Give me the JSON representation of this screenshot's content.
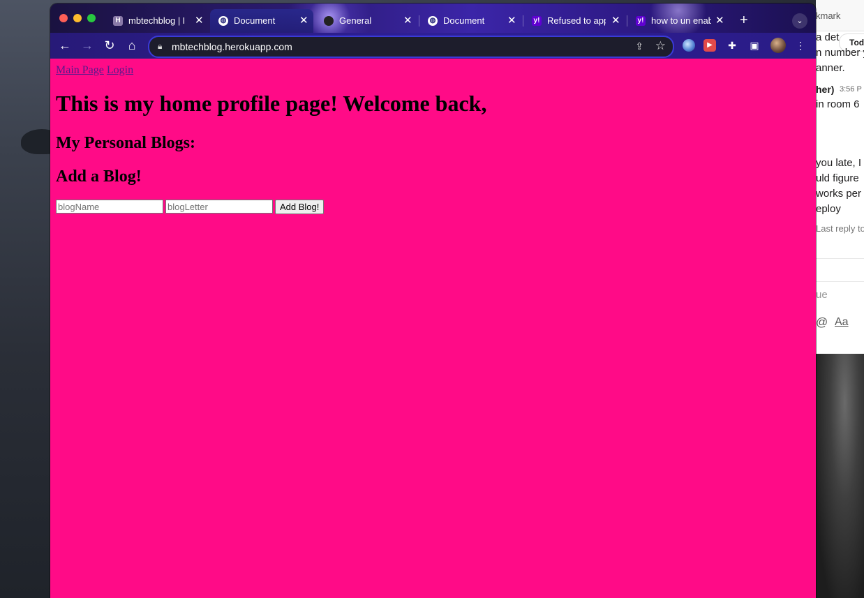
{
  "browser": {
    "tabs": [
      {
        "title": "mbtechblog | H",
        "favicon": "heroku-icon"
      },
      {
        "title": "Document",
        "favicon": "globe-icon",
        "active": true
      },
      {
        "title": "General",
        "favicon": "github-icon"
      },
      {
        "title": "Document",
        "favicon": "globe-icon"
      },
      {
        "title": "Refused to app",
        "favicon": "yahoo-icon"
      },
      {
        "title": "how to un enab",
        "favicon": "yahoo-icon"
      }
    ],
    "url": "mbtechblog.herokuapp.com"
  },
  "side_window": {
    "lines": [
      "kmark",
      "a det",
      "n number y",
      "anner.",
      "her)",
      "3:56 P",
      "in room 6",
      "you late, I",
      "uld figure",
      "works per",
      "eploy",
      "Last reply to",
      "ue",
      "@",
      "Aa"
    ],
    "today_label": "Tod"
  },
  "page": {
    "nav": {
      "main_page": "Main Page",
      "login": "Login"
    },
    "heading": "This is my home profile page! Welcome back,",
    "blogs_heading": "My Personal Blogs:",
    "add_heading": "Add a Blog!",
    "blog_name_placeholder": "blogName",
    "blog_letter_placeholder": "blogLetter",
    "add_button": "Add Blog!"
  },
  "colors": {
    "page_background": "#ff0b87",
    "link": "#551a8b"
  }
}
